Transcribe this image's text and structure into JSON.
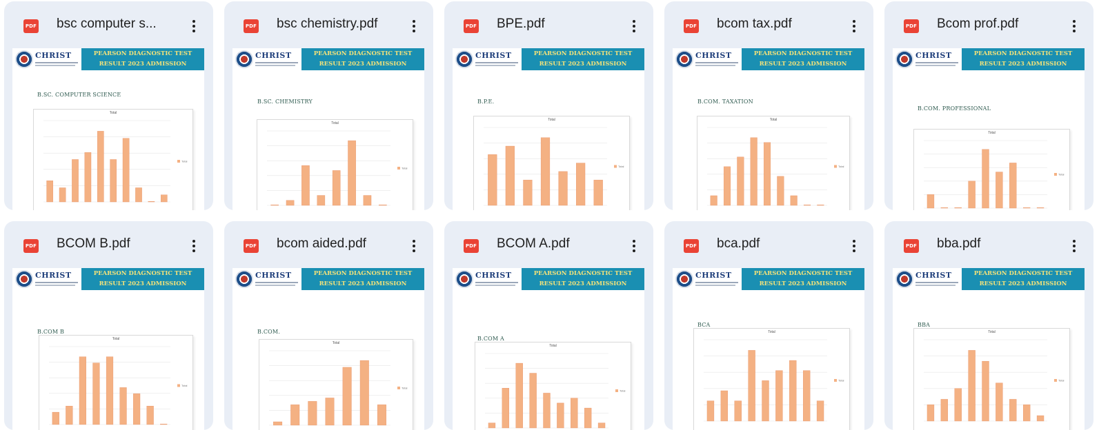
{
  "cards": [
    {
      "file_name": "bsc computer s...",
      "pdf_icon": "PDF",
      "banner_line1": "PEARSON DIAGNOSTIC TEST",
      "banner_line2": "RESULT 2023 ADMISSION",
      "logo_text": "CHRIST",
      "course_title": "B.SC. COMPUTER SCIENCE"
    },
    {
      "file_name": "bsc chemistry.pdf",
      "pdf_icon": "PDF",
      "banner_line1": "PEARSON DIAGNOSTIC TEST",
      "banner_line2": "RESULT 2023 ADMISSION",
      "logo_text": "CHRIST",
      "course_title": "B.SC. CHEMISTRY"
    },
    {
      "file_name": "BPE.pdf",
      "pdf_icon": "PDF",
      "banner_line1": "PEARSON DIAGNOSTIC TEST",
      "banner_line2": "RESULT 2023 ADMISSION",
      "logo_text": "CHRIST",
      "course_title": "B.P.E."
    },
    {
      "file_name": "bcom tax.pdf",
      "pdf_icon": "PDF",
      "banner_line1": "PEARSON DIAGNOSTIC TEST",
      "banner_line2": "RESULT 2023 ADMISSION",
      "logo_text": "CHRIST",
      "course_title": "B.COM. TAXATION"
    },
    {
      "file_name": "Bcom prof.pdf",
      "pdf_icon": "PDF",
      "banner_line1": "PEARSON DIAGNOSTIC TEST",
      "banner_line2": "RESULT 2023 ADMISSION",
      "logo_text": "CHRIST",
      "course_title": "B.COM. PROFESSIONAL"
    },
    {
      "file_name": "BCOM B.pdf",
      "pdf_icon": "PDF",
      "banner_line1": "PEARSON DIAGNOSTIC TEST",
      "banner_line2": "RESULT 2023 ADMISSION",
      "logo_text": "CHRIST",
      "course_title": "B.COM B"
    },
    {
      "file_name": "bcom aided.pdf",
      "pdf_icon": "PDF",
      "banner_line1": "PEARSON DIAGNOSTIC TEST",
      "banner_line2": "RESULT 2023 ADMISSION",
      "logo_text": "CHRIST",
      "course_title": "B.COM."
    },
    {
      "file_name": "BCOM A.pdf",
      "pdf_icon": "PDF",
      "banner_line1": "PEARSON DIAGNOSTIC TEST",
      "banner_line2": "RESULT 2023 ADMISSION",
      "logo_text": "CHRIST",
      "course_title": "B.COM A"
    },
    {
      "file_name": "bca.pdf",
      "pdf_icon": "PDF",
      "banner_line1": "PEARSON DIAGNOSTIC TEST",
      "banner_line2": "RESULT 2023 ADMISSION",
      "logo_text": "CHRIST",
      "course_title": "BCA"
    },
    {
      "file_name": "bba.pdf",
      "pdf_icon": "PDF",
      "banner_line1": "PEARSON DIAGNOSTIC TEST",
      "banner_line2": "RESULT 2023 ADMISSION",
      "logo_text": "CHRIST",
      "course_title": "BBA"
    }
  ],
  "colors": {
    "card_bg": "#e9eef6",
    "pdf_red": "#ea4335",
    "banner_blue": "#1a8fb2",
    "banner_text": "#f3e27a",
    "bar": "#f4b183"
  },
  "icons": {
    "file_type": "pdf-icon",
    "menu": "more-vert-icon"
  },
  "chart_data": [
    {
      "type": "bar",
      "title": "Total",
      "legend": "Total",
      "values": [
        3,
        2,
        6,
        7,
        10,
        6,
        9,
        2,
        0,
        1
      ]
    },
    {
      "type": "bar",
      "title": "Total",
      "legend": "Total",
      "values": [
        0,
        1,
        8,
        2,
        7,
        13,
        2,
        0
      ]
    },
    {
      "type": "bar",
      "title": "Total",
      "legend": "Total",
      "values": [
        6,
        7,
        3,
        8,
        4,
        5,
        3
      ]
    },
    {
      "type": "bar",
      "title": "Total",
      "legend": "Total",
      "values": [
        2,
        8,
        10,
        14,
        13,
        6,
        2,
        0,
        0
      ]
    },
    {
      "type": "bar",
      "title": "Total",
      "legend": "Total",
      "values": [
        3,
        0,
        0,
        6,
        13,
        8,
        10,
        0,
        0
      ]
    },
    {
      "type": "bar",
      "title": "Total",
      "legend": "Total",
      "values": [
        2,
        3,
        11,
        10,
        11,
        6,
        5,
        3,
        0
      ]
    },
    {
      "type": "bar",
      "title": "Total",
      "legend": "Total",
      "values": [
        1,
        6,
        7,
        8,
        17,
        19,
        6
      ]
    },
    {
      "type": "bar",
      "title": "Total",
      "legend": "Total",
      "values": [
        1,
        8,
        13,
        11,
        7,
        5,
        6,
        4,
        1
      ]
    },
    {
      "type": "bar",
      "title": "Total",
      "legend": "Total",
      "values": [
        2,
        3,
        2,
        7,
        4,
        5,
        6,
        5,
        2
      ]
    },
    {
      "type": "bar",
      "title": "Total",
      "legend": "Total",
      "values": [
        3,
        4,
        6,
        13,
        11,
        7,
        4,
        3,
        1
      ]
    }
  ]
}
